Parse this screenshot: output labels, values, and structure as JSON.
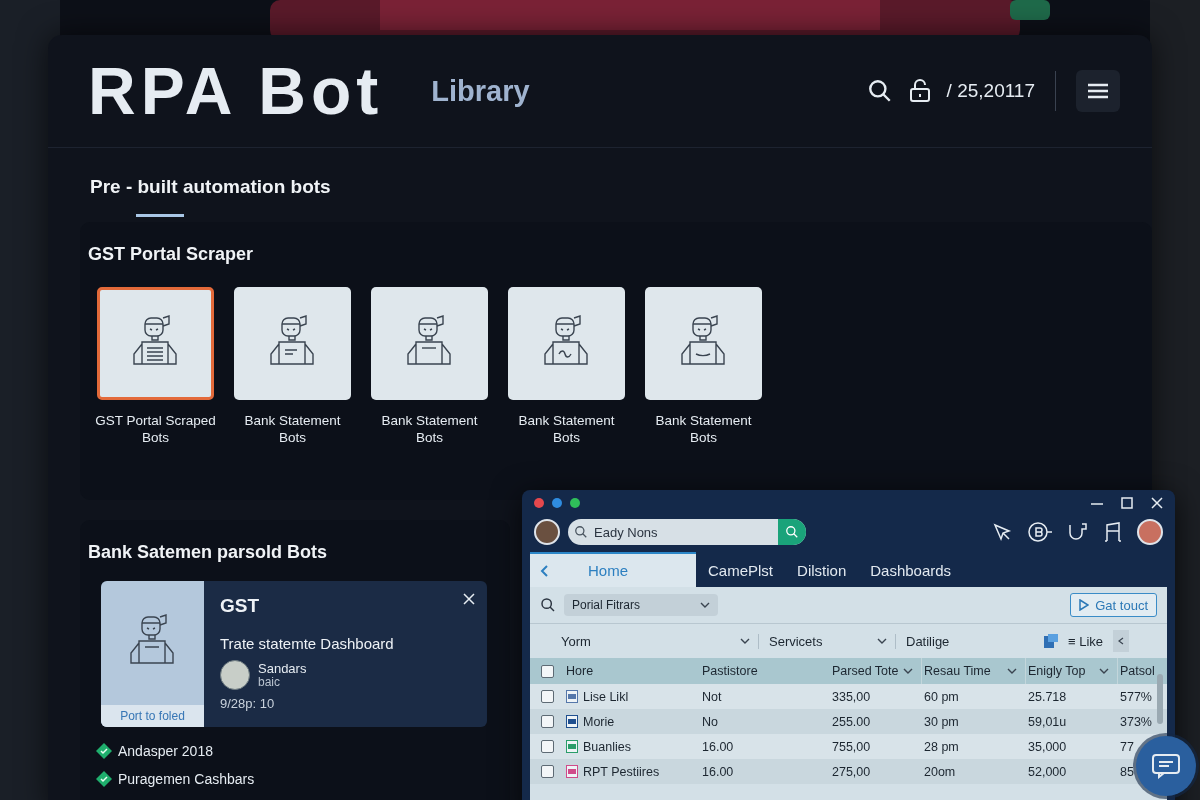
{
  "header": {
    "title": "RPA Bot",
    "subtitle": "Library",
    "counter": "/ 25,20117"
  },
  "tabs": [
    {
      "label": "Pre - built automation bots",
      "selected": true
    }
  ],
  "featured": {
    "title": "GST Portal Scraper",
    "bots": [
      {
        "label": "GST Portal Scraped Bots",
        "selected": true
      },
      {
        "label": "Bank Statement Bots",
        "selected": false
      },
      {
        "label": "Bank Statement Bots",
        "selected": false
      },
      {
        "label": "Bank Statement Bots",
        "selected": false
      },
      {
        "label": "Bank Statement Bots",
        "selected": false
      }
    ]
  },
  "detail_section": {
    "title": "Bank Satemen parsold Bots",
    "card": {
      "caption": "Port to foled",
      "title": "GST",
      "subtitle": "Trate statemte Dashboard",
      "author": "Sandars",
      "role": "baic",
      "date": "9/28p: 10"
    },
    "items": [
      {
        "label": "Andasper 2018"
      },
      {
        "label": "Puragemen Cashbars"
      }
    ]
  },
  "window": {
    "search": {
      "value": "Eady Nons"
    },
    "tabs": [
      {
        "label": "Home",
        "selected": true
      },
      {
        "label": "CamePlst",
        "selected": false
      },
      {
        "label": "Dilstion",
        "selected": false
      },
      {
        "label": "Dashboards",
        "selected": false
      }
    ],
    "filter": {
      "value": "Porial Fitrars"
    },
    "action": "Gat touct",
    "column_filters": [
      {
        "label": "Yorm",
        "kind": "dropdown"
      },
      {
        "label": "Servicets",
        "kind": "dropdown"
      },
      {
        "label": "Datilige",
        "kind": "text"
      }
    ],
    "view_label": "≡ Like",
    "table": {
      "all_checked": false,
      "columns": [
        {
          "label": "Hore",
          "sortable": false
        },
        {
          "label": "Pastistore",
          "sortable": false
        },
        {
          "label": "Parsed Tote",
          "sortable": true
        },
        {
          "label": "Resau Time",
          "sortable": true
        },
        {
          "label": "Enigly Top",
          "sortable": true
        },
        {
          "label": "Patsol",
          "sortable": false
        }
      ],
      "rows": [
        {
          "checked": false,
          "cells": [
            "Lise Likl",
            "Not",
            "335,00",
            "60 pm",
            "25.718",
            "577%"
          ]
        },
        {
          "checked": false,
          "cells": [
            "Morie",
            "No",
            "255.00",
            "30 pm",
            "59,01u",
            "373%"
          ]
        },
        {
          "checked": false,
          "cells": [
            "Buanlies",
            "16.00",
            "755,00",
            "28 pm",
            "35,000",
            "77"
          ]
        },
        {
          "checked": false,
          "cells": [
            "RPT Pestiires",
            "16.00",
            "275,00",
            "20om",
            "52,000",
            "85"
          ]
        }
      ]
    }
  }
}
